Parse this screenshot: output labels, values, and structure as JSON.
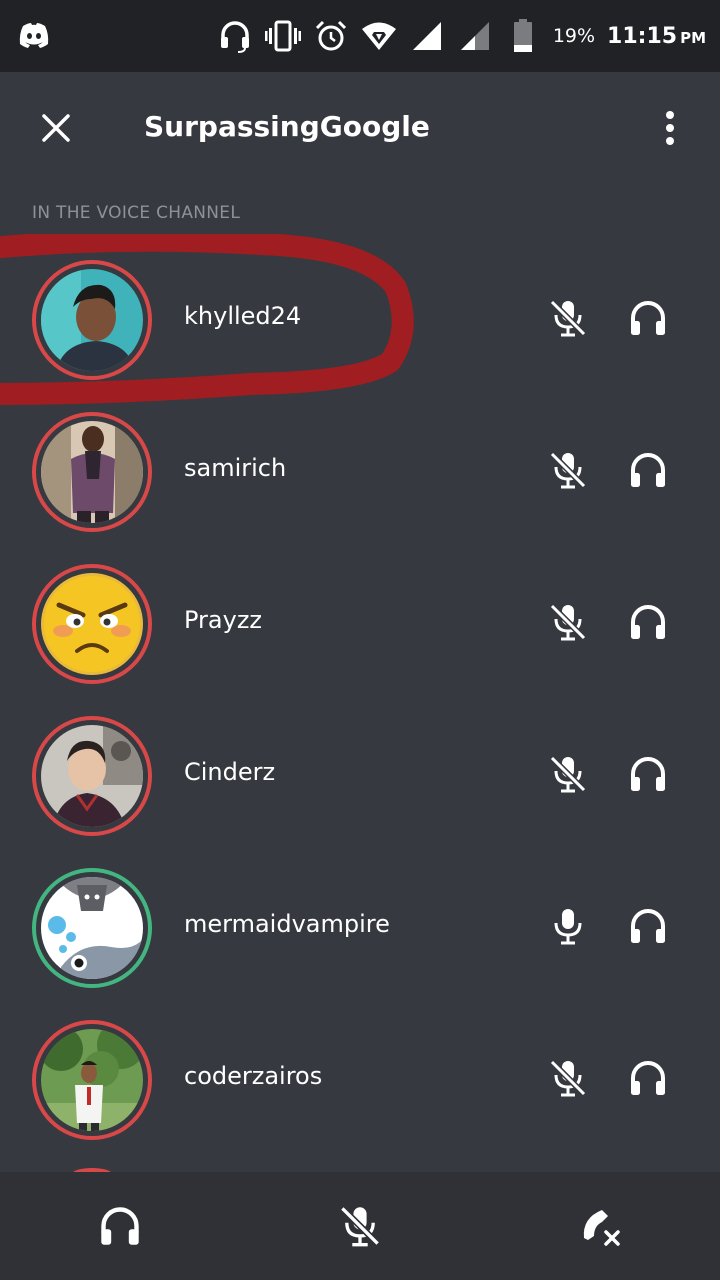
{
  "status_bar": {
    "battery_percent": "19%",
    "time": "11:15",
    "ampm": "PM",
    "icons": [
      "discord-icon",
      "headset-icon",
      "vibrate-icon",
      "alarm-icon",
      "wifi-icon",
      "signal-icon",
      "signal-icon-2",
      "battery-icon"
    ]
  },
  "header": {
    "title": "SurpassingGoogle"
  },
  "section_label": "IN THE VOICE CHANNEL",
  "members": [
    {
      "name": "khylled24",
      "ring": "#d94848",
      "mic": "muted",
      "highlighted": true
    },
    {
      "name": "samirich",
      "ring": "#d94848",
      "mic": "muted"
    },
    {
      "name": "Prayzz",
      "ring": "#d94848",
      "mic": "muted"
    },
    {
      "name": "Cinderz",
      "ring": "#d94848",
      "mic": "muted"
    },
    {
      "name": "mermaidvampire",
      "ring": "#43b581",
      "mic": "active"
    },
    {
      "name": "coderzairos",
      "ring": "#d94848",
      "mic": "muted"
    }
  ],
  "bottom_bar": {
    "buttons": [
      "headphones-icon",
      "mic-muted-icon",
      "hangup-icon"
    ]
  },
  "colors": {
    "background": "#36393f",
    "status_bar": "#202225",
    "bottom_bar": "#2f3136",
    "muted_ring": "#d94848",
    "active_ring": "#43b581",
    "annotation": "#a01e22"
  }
}
